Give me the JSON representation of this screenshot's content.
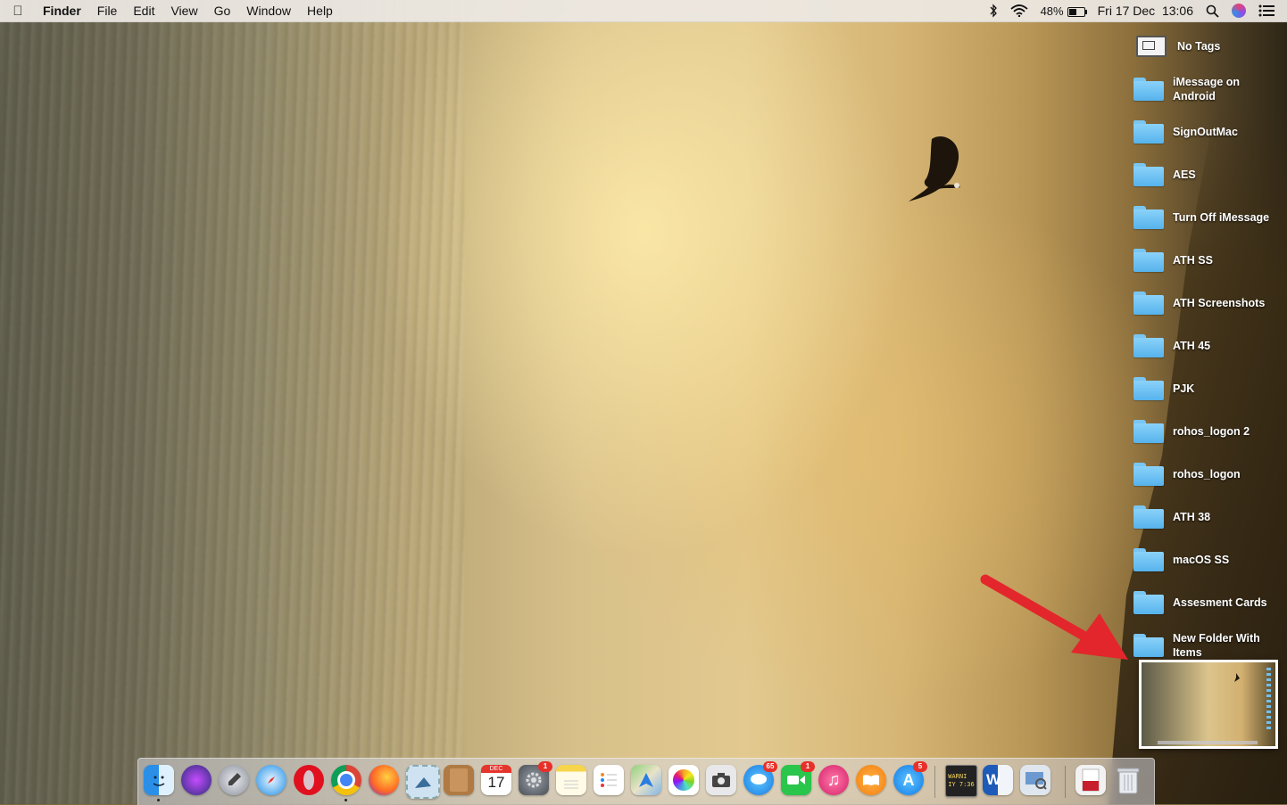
{
  "menubar": {
    "app_name": "Finder",
    "menus": [
      "File",
      "Edit",
      "View",
      "Go",
      "Window",
      "Help"
    ],
    "battery": "48%",
    "datetime": "Fri 17 Dec  13:06"
  },
  "desktop_items": [
    {
      "label": "No Tags",
      "icon": "tag-icon"
    },
    {
      "label": "iMessage on Android",
      "icon": "folder-icon"
    },
    {
      "label": "SignOutMac",
      "icon": "folder-icon"
    },
    {
      "label": "AES",
      "icon": "folder-icon"
    },
    {
      "label": "Turn Off iMessage",
      "icon": "folder-icon"
    },
    {
      "label": "ATH SS",
      "icon": "folder-icon"
    },
    {
      "label": "ATH Screenshots",
      "icon": "folder-icon"
    },
    {
      "label": "ATH 45",
      "icon": "folder-icon"
    },
    {
      "label": "PJK",
      "icon": "folder-icon"
    },
    {
      "label": "rohos_logon 2",
      "icon": "folder-icon"
    },
    {
      "label": "rohos_logon",
      "icon": "folder-icon"
    },
    {
      "label": "ATH 38",
      "icon": "folder-icon"
    },
    {
      "label": "macOS SS",
      "icon": "folder-icon"
    },
    {
      "label": "Assesment Cards",
      "icon": "folder-icon"
    },
    {
      "label": "New Folder With Items",
      "icon": "folder-icon"
    }
  ],
  "dock": {
    "calendar": {
      "month": "DEC",
      "day": "17"
    },
    "badges": {
      "system_preferences": "1",
      "messages": "65",
      "facetime": "1",
      "app_store": "5"
    },
    "console_text": "WARNI\nIY 7:36",
    "word_letter": "W"
  },
  "colors": {
    "folder_blue": "#56b3ec",
    "badge_red": "#e8302a",
    "arrow_red": "#e3262b"
  }
}
